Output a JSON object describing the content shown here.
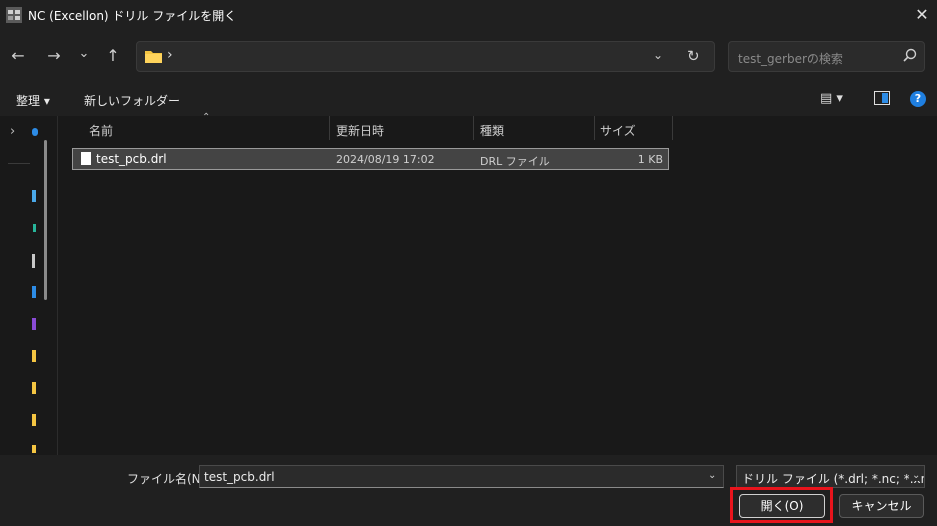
{
  "window": {
    "title": "NC (Excellon) ドリル ファイルを開く",
    "close_glyph": "✕"
  },
  "nav": {
    "back_glyph": "←",
    "forward_glyph": "→",
    "recent_glyph": "⌄",
    "up_glyph": "↑",
    "address_chevron": "›",
    "address_dropdown": "⌄",
    "refresh_glyph": "↻",
    "search_placeholder": "test_gerberの検索"
  },
  "commands": {
    "organize": "整理 ▾",
    "new_folder": "新しいフォルダー",
    "view_glyph": "▤ ▾",
    "help": "?"
  },
  "navpane": {
    "expand_glyph": "›"
  },
  "columns": {
    "name": "名前",
    "modified": "更新日時",
    "type": "種類",
    "size": "サイズ",
    "sort_glyph": "⌃"
  },
  "files": [
    {
      "name": "test_pcb.drl",
      "modified": "2024/08/19 17:02",
      "type": "DRL ファイル",
      "size": "1 KB"
    }
  ],
  "bottom": {
    "filename_label": "ファイル名(N):",
    "filename_value": "test_pcb.drl",
    "filetype_value": "ドリル ファイル (*.drl; *.nc; *.xnc; *.",
    "dropdown_glyph": "⌄",
    "open_label": "開く(O)",
    "cancel_label": "キャンセル"
  },
  "colors": {
    "highlight_border": "#e8141c",
    "help_blue": "#1f7fe0",
    "folder_yellow": "#f4c542"
  }
}
